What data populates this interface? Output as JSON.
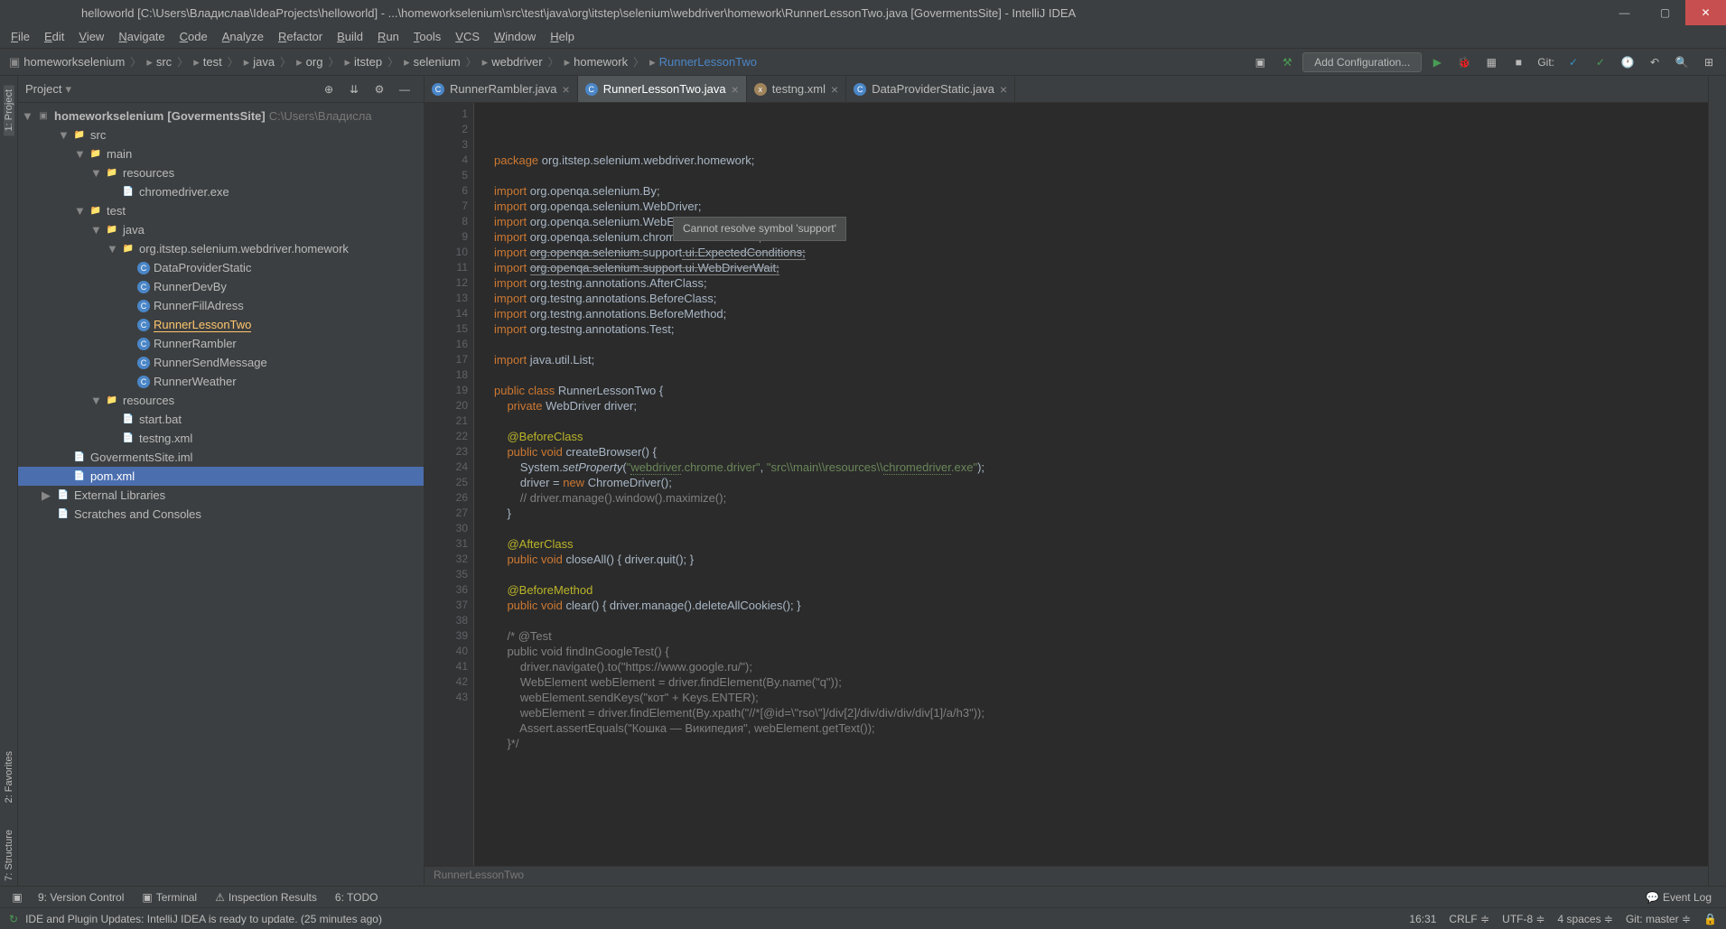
{
  "titlebar": {
    "text": "helloworld [C:\\Users\\Владислав\\IdeaProjects\\helloworld] - ...\\homeworkselenium\\src\\test\\java\\org\\itstep\\selenium\\webdriver\\homework\\RunnerLessonTwo.java [GovermentsSite] - IntelliJ IDEA"
  },
  "menubar": {
    "items": [
      "File",
      "Edit",
      "View",
      "Navigate",
      "Code",
      "Analyze",
      "Refactor",
      "Build",
      "Run",
      "Tools",
      "VCS",
      "Window",
      "Help"
    ]
  },
  "breadcrumb": {
    "items": [
      "homeworkselenium",
      "src",
      "test",
      "java",
      "org",
      "itstep",
      "selenium",
      "webdriver",
      "homework",
      "RunnerLessonTwo"
    ]
  },
  "nav": {
    "config_label": "Add Configuration...",
    "git_label": "Git:"
  },
  "project": {
    "title": "Project",
    "root": "homeworkselenium",
    "root_type": "[GovermentsSite]",
    "root_path": "C:\\Users\\Владисла",
    "items": [
      {
        "indent": 1,
        "label": "src",
        "type": "folder",
        "arrow": "▼"
      },
      {
        "indent": 2,
        "label": "main",
        "type": "folder",
        "arrow": "▼"
      },
      {
        "indent": 3,
        "label": "resources",
        "type": "folder",
        "arrow": "▼"
      },
      {
        "indent": 4,
        "label": "chromedriver.exe",
        "type": "file"
      },
      {
        "indent": 2,
        "label": "test",
        "type": "folder",
        "arrow": "▼"
      },
      {
        "indent": 3,
        "label": "java",
        "type": "test-folder",
        "arrow": "▼"
      },
      {
        "indent": 4,
        "label": "org.itstep.selenium.webdriver.homework",
        "type": "package",
        "arrow": "▼"
      },
      {
        "indent": 5,
        "label": "DataProviderStatic",
        "type": "class"
      },
      {
        "indent": 5,
        "label": "RunnerDevBy",
        "type": "class"
      },
      {
        "indent": 5,
        "label": "RunnerFillAdress",
        "type": "class"
      },
      {
        "indent": 5,
        "label": "RunnerLessonTwo",
        "type": "class",
        "active": true
      },
      {
        "indent": 5,
        "label": "RunnerRambler",
        "type": "class"
      },
      {
        "indent": 5,
        "label": "RunnerSendMessage",
        "type": "class"
      },
      {
        "indent": 5,
        "label": "RunnerWeather",
        "type": "class"
      },
      {
        "indent": 3,
        "label": "resources",
        "type": "folder",
        "arrow": "▼"
      },
      {
        "indent": 4,
        "label": "start.bat",
        "type": "file"
      },
      {
        "indent": 4,
        "label": "testng.xml",
        "type": "xml"
      },
      {
        "indent": 1,
        "label": "GovermentsSite.iml",
        "type": "file"
      },
      {
        "indent": 1,
        "label": "pom.xml",
        "type": "xml",
        "selected": true
      },
      {
        "indent": 0,
        "label": "External Libraries",
        "type": "lib",
        "arrow": "▶"
      },
      {
        "indent": 0,
        "label": "Scratches and Consoles",
        "type": "scratch"
      }
    ]
  },
  "tabs": [
    {
      "name": "RunnerRambler.java",
      "icon": "class",
      "active": false
    },
    {
      "name": "RunnerLessonTwo.java",
      "icon": "class",
      "active": true
    },
    {
      "name": "testng.xml",
      "icon": "xml",
      "active": false
    },
    {
      "name": "DataProviderStatic.java",
      "icon": "class",
      "active": false
    }
  ],
  "tooltip": {
    "text": "Cannot resolve symbol 'support'"
  },
  "code": {
    "lines": [
      {
        "n": 1,
        "html": "<span class='kw'>package</span> org.itstep.selenium.webdriver.homework;"
      },
      {
        "n": 2,
        "html": ""
      },
      {
        "n": 3,
        "html": "<span class='kw'>import</span> org.openqa.selenium.By;"
      },
      {
        "n": 4,
        "html": "<span class='kw'>import</span> org.openqa.selenium.WebDriver;"
      },
      {
        "n": 5,
        "html": "<span class='kw'>import</span> org.openqa.selenium.WebElement;"
      },
      {
        "n": 6,
        "html": "<span class='kw'>import</span> org.openqa.selenium.chrome.ChromeDriver;"
      },
      {
        "n": 7,
        "html": "<span class='kw'>import</span> <span class='warn-underline'>org.openqa.selenium.</span><span class='err-underline'>support</span><span class='warn-underline'>.ui.ExpectedConditions;</span>"
      },
      {
        "n": 8,
        "html": "<span class='kw'>import</span> <span class='warn-underline'>org.openqa.selenium.support.ui.WebDriverWait;</span>"
      },
      {
        "n": 9,
        "html": "<span class='kw'>import</span> org.testng.annotations.AfterClass;"
      },
      {
        "n": 10,
        "html": "<span class='kw'>import</span> org.testng.annotations.BeforeClass;"
      },
      {
        "n": 11,
        "html": "<span class='kw'>import</span> org.testng.annotations.BeforeMethod;"
      },
      {
        "n": 12,
        "html": "<span class='kw'>import</span> org.testng.annotations.Test;"
      },
      {
        "n": 13,
        "html": ""
      },
      {
        "n": 14,
        "html": "<span class='kw'>import</span> java.util.List;"
      },
      {
        "n": 15,
        "html": ""
      },
      {
        "n": 16,
        "html": "<span class='kw'>public class</span> RunnerLessonTwo {"
      },
      {
        "n": 17,
        "html": "    <span class='kw'>private</span> WebDriver driver;"
      },
      {
        "n": 18,
        "html": ""
      },
      {
        "n": 19,
        "html": "    <span class='ann'>@BeforeClass</span>"
      },
      {
        "n": 20,
        "html": "    <span class='kw'>public void</span> createBrowser() {"
      },
      {
        "n": 21,
        "html": "        System.<span style='font-style:italic'>setProperty</span>(<span class='str'>\"<span style='border-bottom:1px dotted #6a8759'>webdriver</span>.chrome.driver\"</span>, <span class='str'>\"src\\\\main\\\\resources\\\\<span style='border-bottom:1px dotted #6a8759'>chromedriver</span>.exe\"</span>);"
      },
      {
        "n": 22,
        "html": "        driver = <span class='kw'>new</span> ChromeDriver();"
      },
      {
        "n": 23,
        "html": "        <span class='com'>// driver.manage().window().maximize();</span>"
      },
      {
        "n": 24,
        "html": "    }"
      },
      {
        "n": 25,
        "html": ""
      },
      {
        "n": 26,
        "html": "    <span class='ann'>@AfterClass</span>"
      },
      {
        "n": 27,
        "html": "    <span class='kw'>public void</span> closeAll() { driver.quit(); }"
      },
      {
        "n": 30,
        "html": ""
      },
      {
        "n": 31,
        "html": "    <span class='ann'>@BeforeMethod</span>"
      },
      {
        "n": 32,
        "html": "    <span class='kw'>public void</span> clear() { driver.manage().deleteAllCookies(); }"
      },
      {
        "n": 35,
        "html": ""
      },
      {
        "n": 36,
        "html": "    <span class='com'>/* @Test</span>"
      },
      {
        "n": 37,
        "html": "<span class='com'>    public void findInGoogleTest() {</span>"
      },
      {
        "n": 38,
        "html": "<span class='com'>        driver.navigate().to(\"https://www.google.ru/\");</span>"
      },
      {
        "n": 39,
        "html": "<span class='com'>        WebElement webElement = driver.findElement(By.name(\"q\"));</span>"
      },
      {
        "n": 40,
        "html": "<span class='com'>        webElement.sendKeys(\"кот\" + Keys.ENTER);</span>"
      },
      {
        "n": 41,
        "html": "<span class='com'>        webElement = driver.findElement(By.xpath(\"//*[@id=\\\"rso\\\"]/div[2]/div/div/div/div[1]/a/h3\"));</span>"
      },
      {
        "n": 42,
        "html": "<span class='com'>        Assert.assertEquals(\"Кошка — Википедия\", webElement.getText());</span>"
      },
      {
        "n": 43,
        "html": "<span class='com'>    }*/</span>"
      }
    ],
    "breadcrumb": "RunnerLessonTwo"
  },
  "bottom": {
    "items": [
      "9: Version Control",
      "Terminal",
      "Inspection Results",
      "6: TODO"
    ],
    "event_log": "Event Log"
  },
  "status": {
    "message": "IDE and Plugin Updates: IntelliJ IDEA is ready to update. (25 minutes ago)",
    "position": "16:31",
    "line_sep": "CRLF",
    "encoding": "UTF-8",
    "indent": "4 spaces",
    "git": "Git: master"
  },
  "left_tools": [
    "1: Project",
    "2: Favorites",
    "7: Structure"
  ]
}
